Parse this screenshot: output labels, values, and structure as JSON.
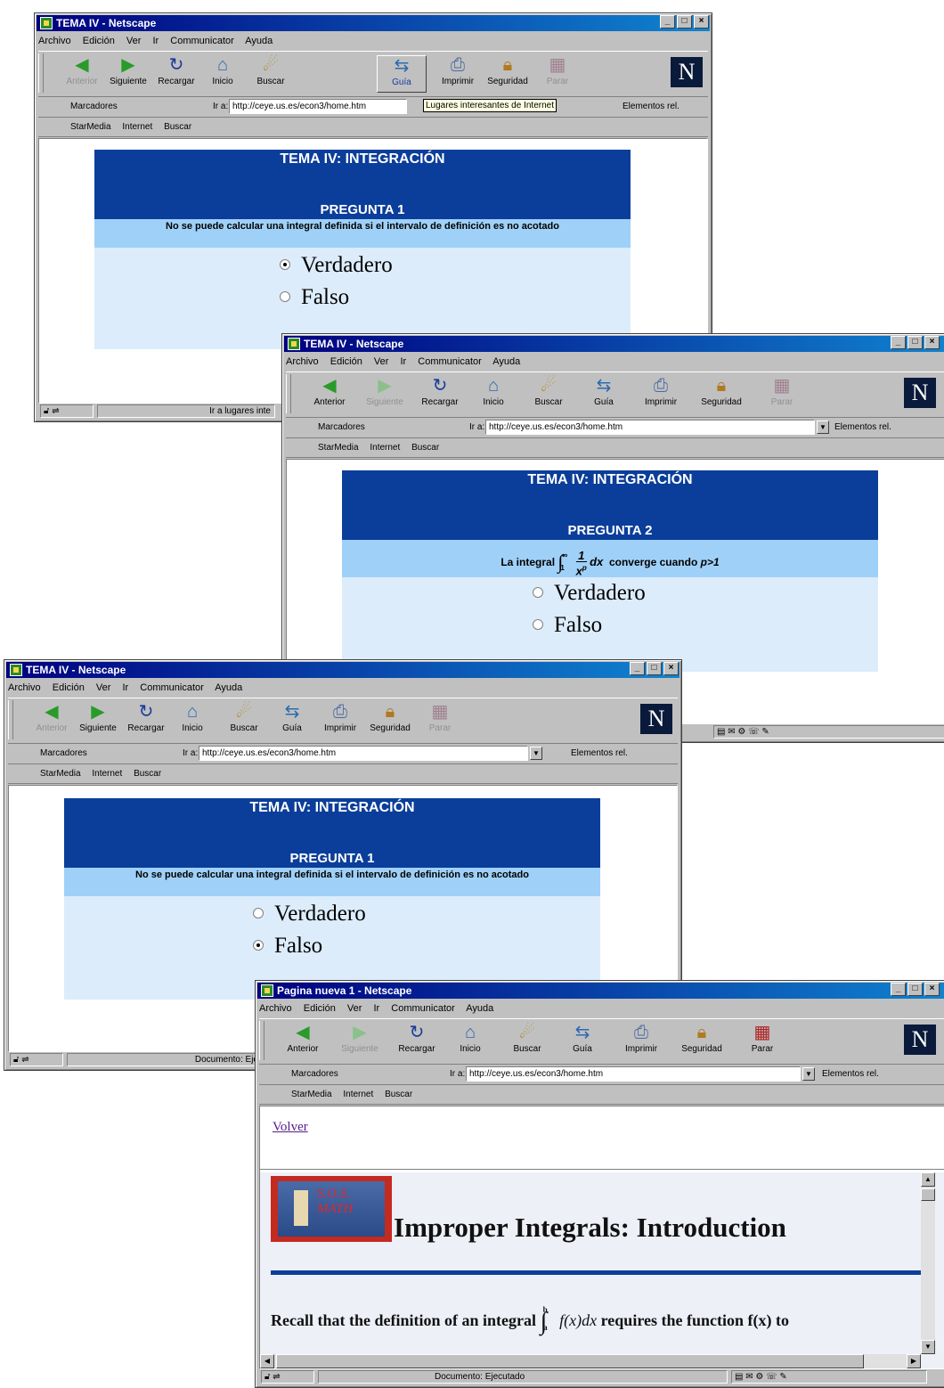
{
  "browser": {
    "menu": [
      "Archivo",
      "Edición",
      "Ver",
      "Ir",
      "Communicator",
      "Ayuda"
    ],
    "toolbar": [
      "Anterior",
      "Siguiente",
      "Recargar",
      "Inicio",
      "Buscar",
      "Guía",
      "Imprimir",
      "Seguridad",
      "Parar"
    ],
    "bookmarks_label": "Marcadores",
    "goto_label": "Ir a:",
    "url": "http://ceye.us.es/econ3/home.htm",
    "related_label": "Elementos rel.",
    "personal": [
      "StarMedia",
      "Internet",
      "Buscar"
    ]
  },
  "windows": [
    {
      "title": "TEMA IV - Netscape",
      "tooltip": "Lugares interesantes de Internet",
      "status": "Ir a lugares inte",
      "quiz": {
        "heading": "TEMA IV: INTEGRACIÓN",
        "question_title": "PREGUNTA 1",
        "question": "No se puede calcular una integral definida si el intervalo de definición es no acotado",
        "options": [
          "Verdadero",
          "Falso"
        ]
      }
    },
    {
      "title": "TEMA IV - Netscape",
      "quiz": {
        "heading": "TEMA IV: INTEGRACIÓN",
        "question_title": "PREGUNTA 2",
        "question_prefix": "La integral",
        "integral_lower": "1",
        "integral_upper": "∞",
        "fraction_num": "1",
        "fraction_den": "x",
        "fraction_exp": "p",
        "question_suffix": "converge cuando",
        "condition": "p>1",
        "options": [
          "Verdadero",
          "Falso"
        ]
      }
    },
    {
      "title": "TEMA IV - Netscape",
      "status": "Documento: Eje",
      "quiz": {
        "heading": "TEMA IV: INTEGRACIÓN",
        "question_title": "PREGUNTA 1",
        "question": "No se puede calcular una integral definida si el intervalo de definición es no acotado",
        "options": [
          "Verdadero",
          "Falso"
        ]
      }
    },
    {
      "title": "Pagina nueva 1 - Netscape",
      "link": "Volver",
      "logo_text": "S.O.S. MATH",
      "page_title": "Improper Integrals: Introduction",
      "body_prefix": "Recall that the definition of an integral",
      "body_expr": "f(x)dx",
      "body_suffix": "requires the function f(x) to",
      "integral_lower": "a",
      "integral_upper": "b",
      "status": "Documento: Ejecutado"
    }
  ],
  "selected": [
    0,
    null,
    1
  ],
  "colors": {
    "title_bar": "#000080",
    "quiz_header": "#0b3e9a",
    "question_band": "#9fd0f8",
    "quiz_body": "#dcecfb",
    "link": "#551a8b"
  }
}
